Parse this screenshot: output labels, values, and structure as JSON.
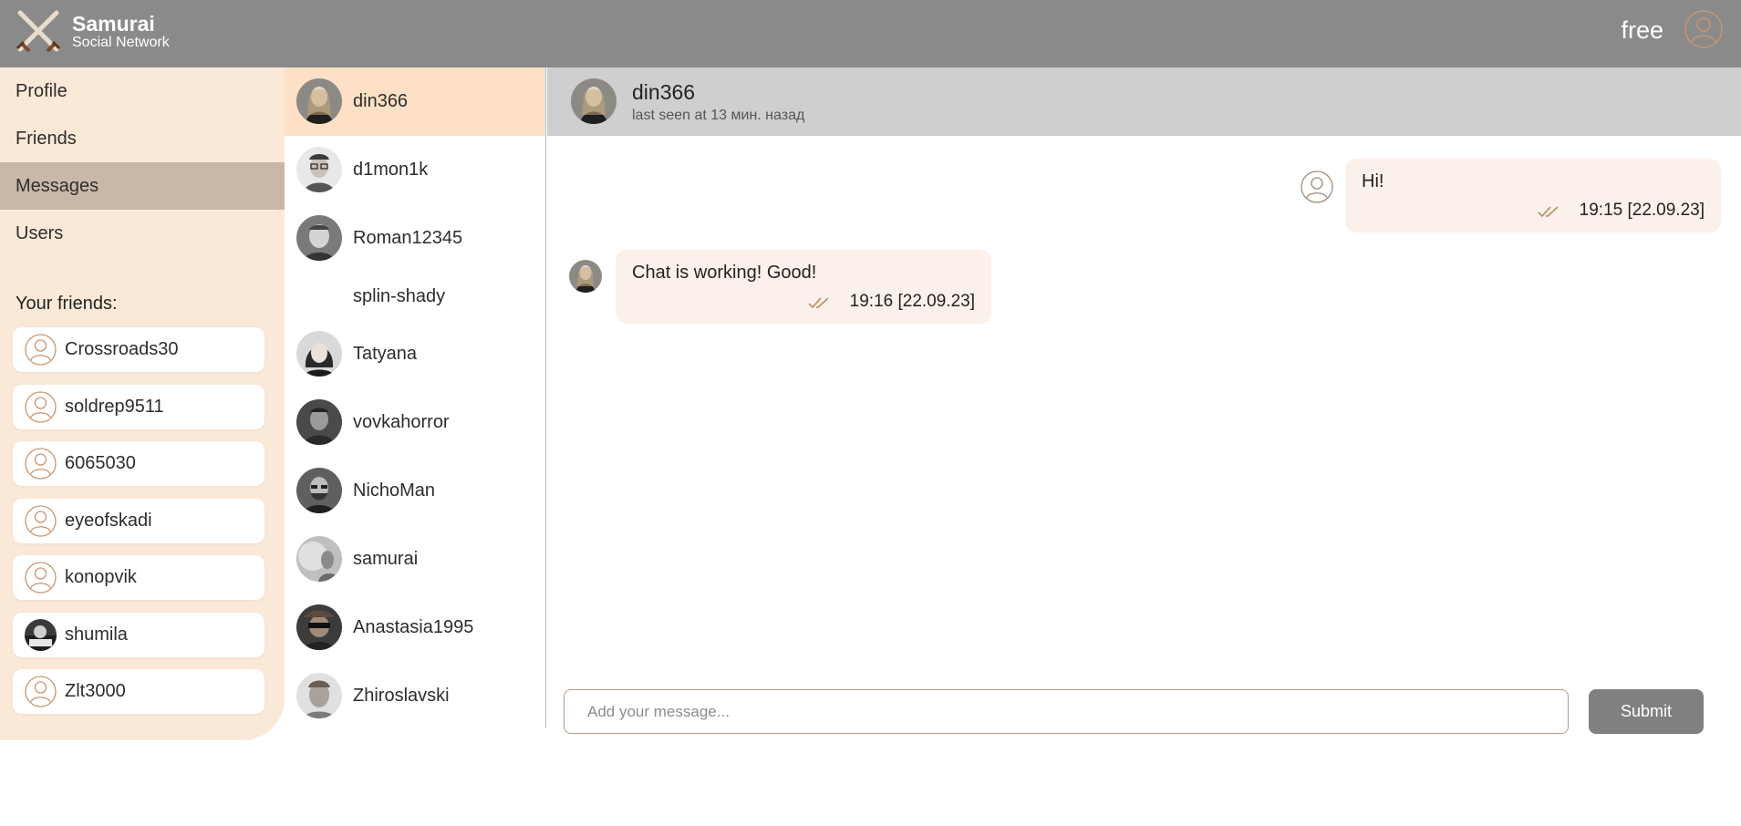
{
  "header": {
    "brand_title": "Samurai",
    "brand_subtitle": "Social Network",
    "login_name": "free",
    "logo_icon": "crossed-swords-icon",
    "bg_color": "#8a8a8a"
  },
  "nav": {
    "items": [
      {
        "label": "Profile",
        "active": false
      },
      {
        "label": "Friends",
        "active": false
      },
      {
        "label": "Messages",
        "active": true
      },
      {
        "label": "Users",
        "active": false
      }
    ],
    "friends_title": "Your friends:",
    "friends": [
      {
        "name": "Crossroads30",
        "avatar": "user-outline-icon"
      },
      {
        "name": "soldrep9511",
        "avatar": "user-outline-icon"
      },
      {
        "name": "6065030",
        "avatar": "user-outline-icon"
      },
      {
        "name": "eyeofskadi",
        "avatar": "user-outline-icon"
      },
      {
        "name": "konopvik",
        "avatar": "user-outline-icon"
      },
      {
        "name": "shumila",
        "avatar": "photo"
      },
      {
        "name": "Zlt3000",
        "avatar": "user-outline-icon"
      }
    ]
  },
  "dialogs": [
    {
      "name": "din366",
      "active": true,
      "has_avatar": true
    },
    {
      "name": "d1mon1k",
      "active": false,
      "has_avatar": true
    },
    {
      "name": "Roman12345",
      "active": false,
      "has_avatar": true
    },
    {
      "name": "splin-shady",
      "active": false,
      "has_avatar": false
    },
    {
      "name": "Tatyana",
      "active": false,
      "has_avatar": true
    },
    {
      "name": "vovkahorror",
      "active": false,
      "has_avatar": true
    },
    {
      "name": "NichoMan",
      "active": false,
      "has_avatar": true
    },
    {
      "name": "samurai",
      "active": false,
      "has_avatar": true
    },
    {
      "name": "Anastasia1995",
      "active": false,
      "has_avatar": true
    },
    {
      "name": "Zhiroslavski",
      "active": false,
      "has_avatar": true
    }
  ],
  "chat": {
    "header": {
      "name": "din366",
      "last_seen": "last seen at 13 мин. назад"
    },
    "messages": [
      {
        "text": "Hi!",
        "time": "19:15 [22.09.23]",
        "own": true,
        "status_icon": "double-check-icon"
      },
      {
        "text": "Chat is working! Good!",
        "time": "19:16 [22.09.23]",
        "own": false,
        "status_icon": "double-check-icon"
      }
    ],
    "composer": {
      "placeholder": "Add your message...",
      "value": "",
      "submit_label": "Submit"
    }
  },
  "colors": {
    "accent": "#c8956f",
    "nav_bg": "#fbe9d8",
    "nav_active": "#c9b8a8",
    "dialog_active": "#fee0c6",
    "message_bg": "#fcf1ea",
    "chat_header_bg": "#cfcfcf",
    "submit_bg": "#808080"
  }
}
